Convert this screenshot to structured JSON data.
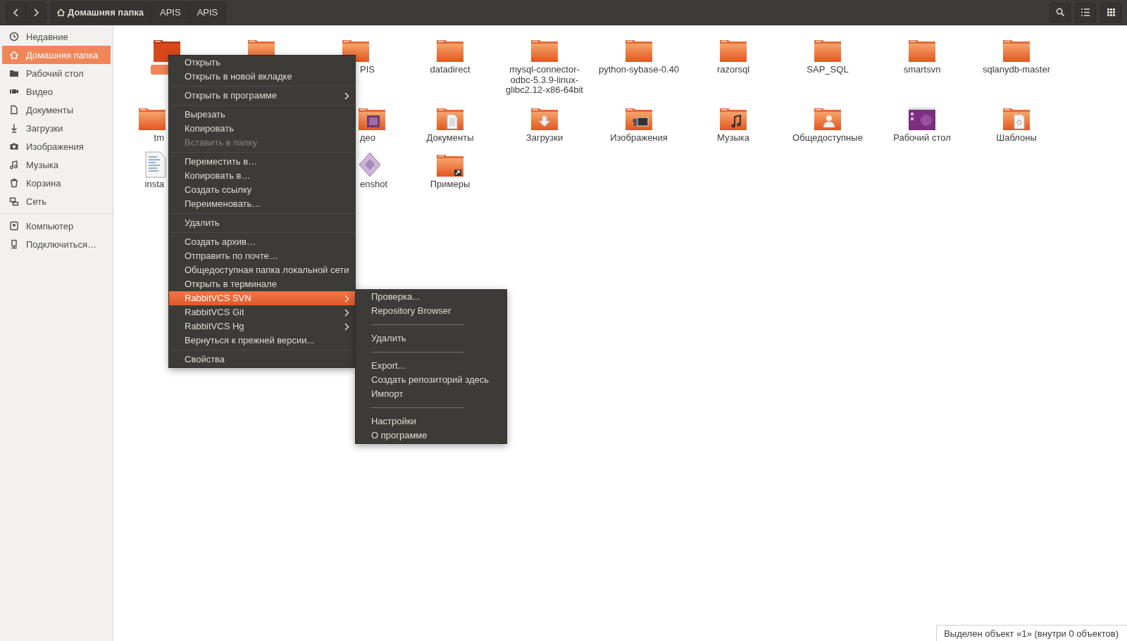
{
  "toolbar": {
    "path": [
      {
        "label": "Домашняя папка",
        "kind": "home"
      },
      {
        "label": "APIS",
        "kind": "plain"
      },
      {
        "label": "APIS",
        "kind": "plain"
      }
    ]
  },
  "sidebar": {
    "groups": [
      [
        {
          "label": "Недавние",
          "kind": "recent",
          "selected": false
        },
        {
          "label": "Домашняя папка",
          "kind": "home",
          "selected": true
        },
        {
          "label": "Рабочий стол",
          "kind": "desktop",
          "selected": false
        },
        {
          "label": "Видео",
          "kind": "video",
          "selected": false
        },
        {
          "label": "Документы",
          "kind": "documents",
          "selected": false
        },
        {
          "label": "Загрузки",
          "kind": "downloads",
          "selected": false
        },
        {
          "label": "Изображения",
          "kind": "pictures",
          "selected": false
        },
        {
          "label": "Музыка",
          "kind": "music",
          "selected": false
        },
        {
          "label": "Корзина",
          "kind": "trash",
          "selected": false
        },
        {
          "label": "Сеть",
          "kind": "network",
          "selected": false
        }
      ],
      [
        {
          "label": "Компьютер",
          "kind": "computer",
          "selected": false
        },
        {
          "label": "Подключиться…",
          "kind": "connect",
          "selected": false
        }
      ]
    ]
  },
  "files": {
    "columns": [
      [
        {
          "kind": "folder",
          "selected": true
        },
        {
          "label": "tm",
          "kind": "folder",
          "selected": false
        },
        {
          "label": "insta",
          "kind": "text-file",
          "selected": false
        }
      ],
      [
        {
          "kind": "folder",
          "selected": false
        }
      ],
      [
        {
          "label": "PIS",
          "kind": "folder",
          "selected": false
        },
        {
          "label": "део",
          "kind": "video-folder",
          "selected": false
        },
        {
          "label": "enshot",
          "kind": "image-file",
          "selected": false
        }
      ],
      [
        {
          "label": "datadirect",
          "kind": "folder",
          "selected": false
        },
        {
          "label": "Документы",
          "kind": "documents-folder",
          "selected": false
        },
        {
          "label": "Примеры",
          "kind": "link-folder",
          "selected": false
        }
      ],
      [
        {
          "label": "mysql-connector-odbc-5.3.9-linux-glibc2.12-x86-64bit",
          "kind": "folder",
          "selected": false
        },
        {
          "label": "Загрузки",
          "kind": "downloads-folder",
          "selected": false
        }
      ],
      [
        {
          "label": "python-sybase-0.40",
          "kind": "folder",
          "selected": false
        },
        {
          "label": "Изображения",
          "kind": "pictures-folder",
          "selected": false
        }
      ],
      [
        {
          "label": "razorsql",
          "kind": "folder",
          "selected": false
        },
        {
          "label": "Музыка",
          "kind": "music-folder",
          "selected": false
        }
      ],
      [
        {
          "label": "SAP_SQL",
          "kind": "folder",
          "selected": false
        },
        {
          "label": "Общедоступные",
          "kind": "public-folder",
          "selected": false
        }
      ],
      [
        {
          "label": "smartsvn",
          "kind": "folder",
          "selected": false
        },
        {
          "label": "Рабочий стол",
          "kind": "desktop-folder",
          "selected": false
        }
      ],
      [
        {
          "label": "sqlanydb-master",
          "kind": "folder",
          "selected": false
        },
        {
          "label": "Шаблоны",
          "kind": "templates-folder",
          "selected": false
        }
      ]
    ]
  },
  "context_menu": {
    "items": [
      {
        "kind": "item",
        "label": "Открыть",
        "disabled": false,
        "submenu": false,
        "selected": false
      },
      {
        "kind": "item",
        "label": "Открыть в новой вкладке",
        "disabled": false,
        "submenu": false,
        "selected": false
      },
      {
        "kind": "separator"
      },
      {
        "kind": "item",
        "label": "Открыть в программе",
        "disabled": false,
        "submenu": true,
        "selected": false
      },
      {
        "kind": "separator"
      },
      {
        "kind": "item",
        "label": "Вырезать",
        "disabled": false,
        "submenu": false,
        "selected": false
      },
      {
        "kind": "item",
        "label": "Копировать",
        "disabled": false,
        "submenu": false,
        "selected": false
      },
      {
        "kind": "item",
        "label": "Вставить в папку",
        "disabled": true,
        "submenu": false,
        "selected": false
      },
      {
        "kind": "separator"
      },
      {
        "kind": "item",
        "label": "Переместить в…",
        "disabled": false,
        "submenu": false,
        "selected": false
      },
      {
        "kind": "item",
        "label": "Копировать в…",
        "disabled": false,
        "submenu": false,
        "selected": false
      },
      {
        "kind": "item",
        "label": "Создать ссылку",
        "disabled": false,
        "submenu": false,
        "selected": false
      },
      {
        "kind": "item",
        "label": "Переименовать…",
        "disabled": false,
        "submenu": false,
        "selected": false
      },
      {
        "kind": "separator"
      },
      {
        "kind": "item",
        "label": "Удалить",
        "disabled": false,
        "submenu": false,
        "selected": false
      },
      {
        "kind": "separator"
      },
      {
        "kind": "item",
        "label": "Создать архив…",
        "disabled": false,
        "submenu": false,
        "selected": false
      },
      {
        "kind": "item",
        "label": "Отправить по почте…",
        "disabled": false,
        "submenu": false,
        "selected": false
      },
      {
        "kind": "item",
        "label": "Общедоступная папка локальной сети",
        "disabled": false,
        "submenu": false,
        "selected": false
      },
      {
        "kind": "item",
        "label": "Открыть в терминале",
        "disabled": false,
        "submenu": false,
        "selected": false
      },
      {
        "kind": "item",
        "label": "RabbitVCS SVN",
        "disabled": false,
        "submenu": true,
        "selected": true
      },
      {
        "kind": "item",
        "label": "RabbitVCS Git",
        "disabled": false,
        "submenu": true,
        "selected": false
      },
      {
        "kind": "item",
        "label": "RabbitVCS Hg",
        "disabled": false,
        "submenu": true,
        "selected": false
      },
      {
        "kind": "item",
        "label": "Вернуться к прежней версии...",
        "disabled": false,
        "submenu": false,
        "selected": false
      },
      {
        "kind": "separator"
      },
      {
        "kind": "item",
        "label": "Свойства",
        "disabled": false,
        "submenu": false,
        "selected": false
      }
    ]
  },
  "submenu": {
    "items": [
      {
        "kind": "item",
        "label": "Проверка...",
        "disabled": false,
        "submenu": false,
        "selected": false
      },
      {
        "kind": "item",
        "label": "Repository Browser",
        "disabled": false,
        "submenu": false,
        "selected": false
      },
      {
        "kind": "line"
      },
      {
        "kind": "item",
        "label": "Удалить",
        "disabled": false,
        "submenu": false,
        "selected": false
      },
      {
        "kind": "line"
      },
      {
        "kind": "item",
        "label": "Export...",
        "disabled": false,
        "submenu": false,
        "selected": false
      },
      {
        "kind": "item",
        "label": "Создать репозиторий здесь",
        "disabled": false,
        "submenu": false,
        "selected": false
      },
      {
        "kind": "item",
        "label": "Импорт",
        "disabled": false,
        "submenu": false,
        "selected": false
      },
      {
        "kind": "line"
      },
      {
        "kind": "item",
        "label": "Настройки",
        "disabled": false,
        "submenu": false,
        "selected": false
      },
      {
        "kind": "item",
        "label": "О программе",
        "disabled": false,
        "submenu": false,
        "selected": false
      }
    ]
  },
  "status_bar": {
    "text": "Выделен объект «1»  (внутри 0 объектов)"
  }
}
